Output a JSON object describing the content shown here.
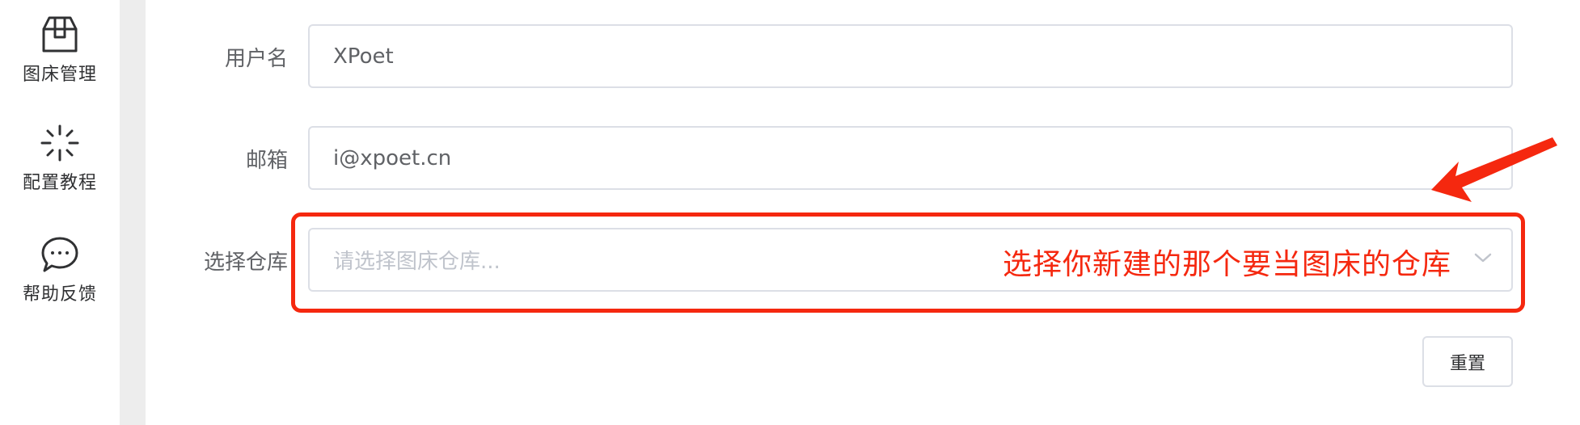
{
  "sidebar": {
    "items": [
      {
        "label": "图床管理",
        "icon": "box-icon"
      },
      {
        "label": "配置教程",
        "icon": "sparkle-icon"
      },
      {
        "label": "帮助反馈",
        "icon": "chat-bubble-icon"
      }
    ]
  },
  "form": {
    "username": {
      "label": "用户名",
      "value": "XPoet"
    },
    "email": {
      "label": "邮箱",
      "value": "i@xpoet.cn"
    },
    "repo": {
      "label": "选择仓库",
      "placeholder": "请选择图床仓库..."
    },
    "reset_label": "重置"
  },
  "annotation": {
    "text": "选择你新建的那个要当图床的仓库",
    "color": "#f5280f"
  },
  "colors": {
    "accent_red": "#f5280f",
    "border": "#dcdfe6",
    "label_text": "#606266"
  }
}
